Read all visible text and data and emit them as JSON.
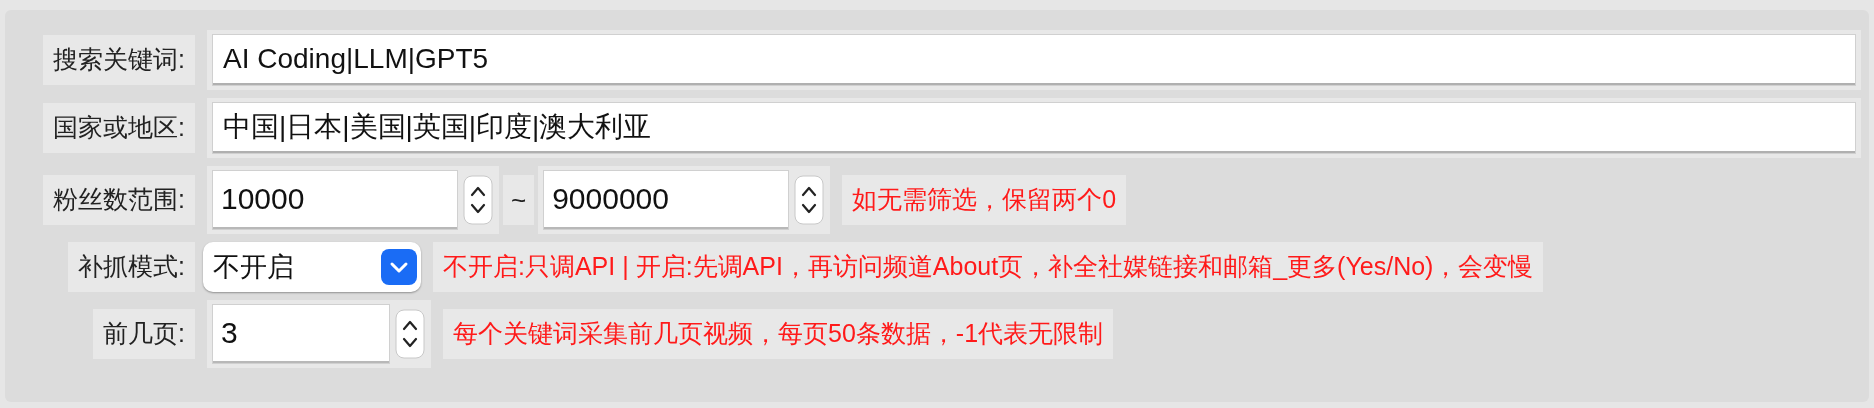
{
  "fields": [
    {
      "kind": "text",
      "label": "搜索关键词:",
      "value": "AI Coding|LLM|GPT5"
    },
    {
      "kind": "text",
      "label": "国家或地区:",
      "value": "中国|日本|美国|英国|印度|澳大利亚"
    },
    {
      "kind": "range",
      "label": "粉丝数范围:",
      "min": "10000",
      "separator": "~",
      "max": "9000000",
      "hint": "如无需筛选，保留两个0"
    },
    {
      "kind": "select",
      "label": "补抓模式:",
      "value": "不开启",
      "hint": "不开启:只调API | 开启:先调API，再访问频道About页，补全社媒链接和邮箱_更多(Yes/No)，会变慢"
    },
    {
      "kind": "number",
      "label": "前几页:",
      "value": "3",
      "hint": "每个关键词采集前几页视频，每页50条数据，-1代表无限制"
    }
  ]
}
